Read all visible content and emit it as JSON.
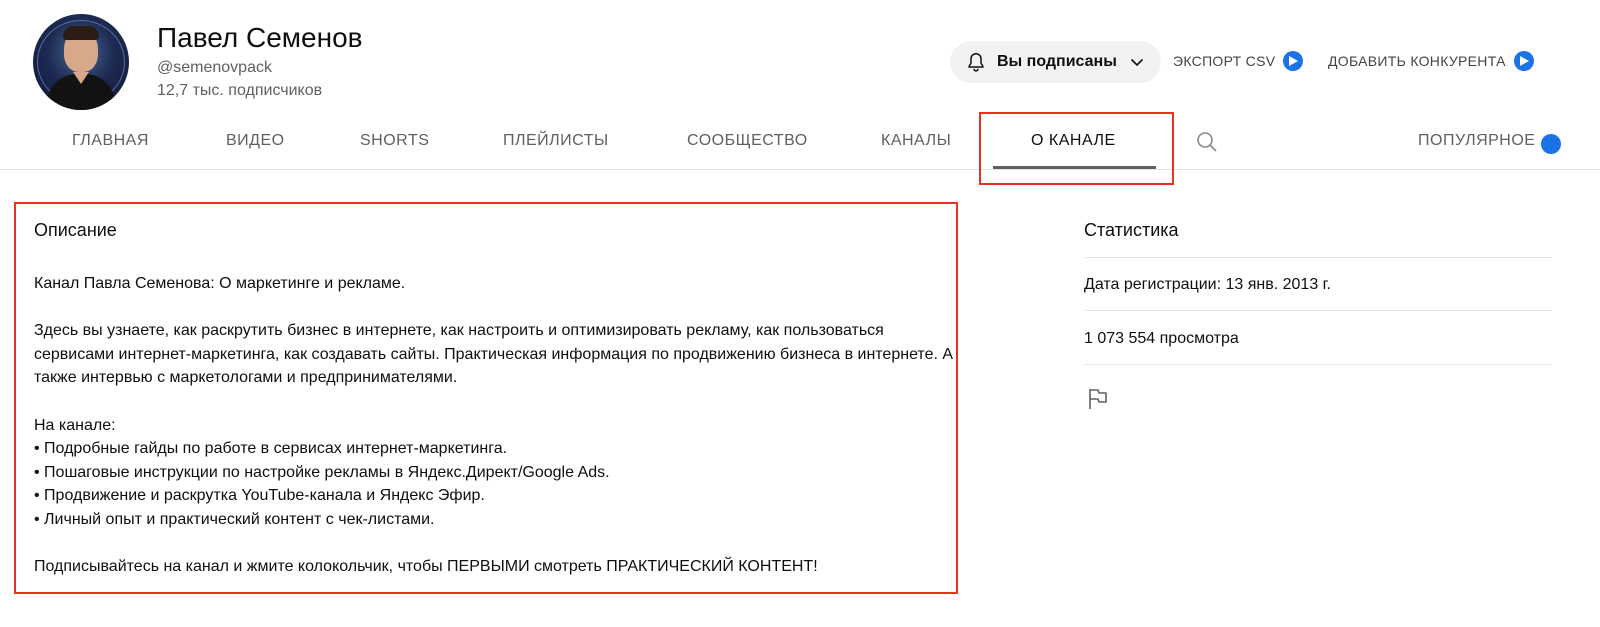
{
  "channel": {
    "name": "Павел Семенов",
    "handle": "@semenovpack",
    "subscribers": "12,7 тыс. подписчиков",
    "avatar_icon": "avatar-image"
  },
  "header_actions": {
    "subscribe_label": "Вы подписаны",
    "subscribe_icon": "bell-icon",
    "export_label": "ЭКСПОРТ CSV",
    "add_competitor_label": "ДОБАВИТЬ КОНКУРЕНТА",
    "extension_icon": "extension-badge-icon"
  },
  "tabs": [
    {
      "label": "ГЛАВНАЯ"
    },
    {
      "label": "ВИДЕО"
    },
    {
      "label": "SHORTS"
    },
    {
      "label": "ПЛЕЙЛИСТЫ"
    },
    {
      "label": "СООБЩЕСТВО"
    },
    {
      "label": "КАНАЛЫ"
    },
    {
      "label": "О КАНАЛЕ",
      "active": true
    },
    {
      "label": "ПОПУЛЯРНОЕ"
    }
  ],
  "description": {
    "title": "Описание",
    "intro": "Канал Павла Семенова: О маркетинге и рекламе.",
    "paragraph": "Здесь вы узнаете, как раскрутить бизнес в интернете, как настроить и оптимизировать рекламу, как пользоваться сервисами интернет-маркетинга, как создавать сайты. Практическая информация по продвижению бизнеса в интернете. А также интервью с маркетологами и предпринимателями.",
    "list_heading": "На канале:",
    "list_items": [
      "• Подробные гайды по работе в сервисах интернет-маркетинга.",
      "• Пошаговые инструкции по настройке рекламы в Яндекс.Директ/Google Ads.",
      "• Продвижение и раскрутка YouTube-канала и Яндекс Эфир.",
      "• Личный опыт и практический контент с чек-листами."
    ],
    "outro": "Подписывайтесь на канал и жмите колокольчик, чтобы ПЕРВЫМИ смотреть ПРАКТИЧЕСКИЙ КОНТЕНТ!"
  },
  "stats": {
    "title": "Статистика",
    "registration": "Дата регистрации: 13 янв. 2013 г.",
    "views": "1 073 554 просмотра",
    "report_icon": "flag-icon"
  },
  "colors": {
    "highlight": "#e8321e",
    "text_primary": "#0f0f0f",
    "text_secondary": "#606060",
    "button_bg": "#f2f2f2",
    "extension_blue": "#1a73e8"
  }
}
